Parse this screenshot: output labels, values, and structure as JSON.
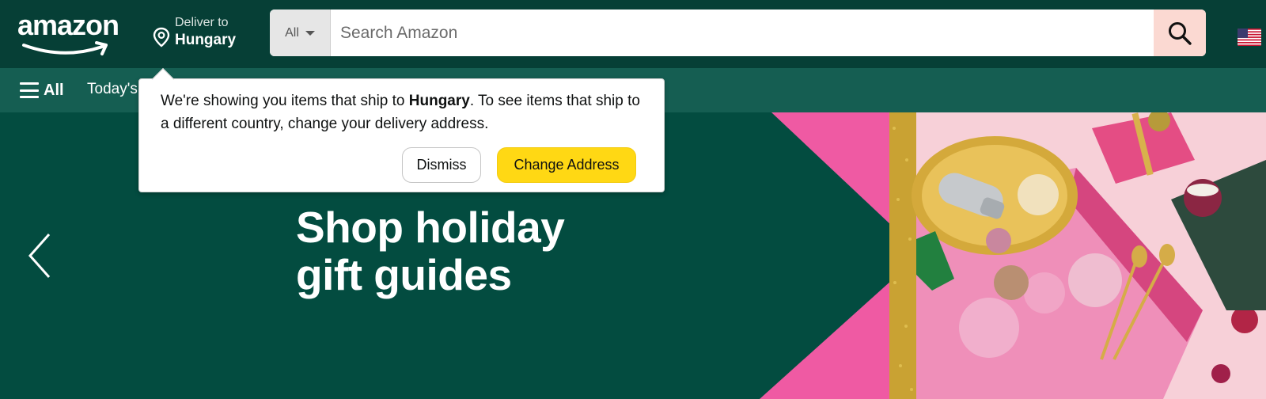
{
  "header": {
    "logo_text": "amazon",
    "deliver_line1": "Deliver to",
    "deliver_country": "Hungary",
    "search": {
      "department": "All",
      "placeholder": "Search Amazon"
    },
    "flag_icon": "us-flag-icon"
  },
  "nav": {
    "menu_label": "All",
    "items": [
      "Today's"
    ]
  },
  "popover": {
    "message_part1": "We're showing you items that ship to ",
    "country": "Hungary",
    "message_part2": ". To see items that ship to a different country, change your delivery address.",
    "dismiss_label": "Dismiss",
    "change_label": "Change Address"
  },
  "hero": {
    "title_line1": "Shop holiday",
    "title_line2": "gift guides"
  },
  "colors": {
    "header_bg": "#063f36",
    "nav_bg": "#155e52",
    "hero_bg": "#034c40",
    "cta_yellow": "#ffd814",
    "search_button_bg": "#fbd9d2",
    "accent_pink": "#ef5aa3"
  }
}
